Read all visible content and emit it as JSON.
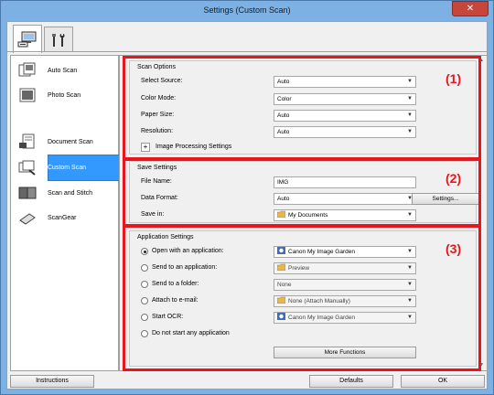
{
  "window": {
    "title": "Settings (Custom Scan)",
    "close_label": "✕"
  },
  "tabs": [
    {
      "icon": "scan-from-computer-icon",
      "active": true
    },
    {
      "icon": "general-settings-tools-icon",
      "active": false
    }
  ],
  "sidebar": {
    "items": [
      {
        "label": "Auto Scan",
        "icon": "auto-scan-icon"
      },
      {
        "label": "Photo Scan",
        "icon": "photo-scan-icon"
      },
      {
        "label": "Document Scan",
        "icon": "document-scan-icon"
      },
      {
        "label": "Custom Scan",
        "icon": "custom-scan-icon",
        "selected": true
      },
      {
        "label": "Scan and Stitch",
        "icon": "scan-and-stitch-icon"
      },
      {
        "label": "ScanGear",
        "icon": "scangear-icon"
      }
    ]
  },
  "scan_options": {
    "title": "Scan Options",
    "marker": "(1)",
    "rows": [
      {
        "label": "Select Source:",
        "value": "Auto"
      },
      {
        "label": "Color Mode:",
        "value": "Color"
      },
      {
        "label": "Paper Size:",
        "value": "Auto"
      },
      {
        "label": "Resolution:",
        "value": "Auto"
      }
    ],
    "image_processing_label": "Image Processing Settings",
    "expand_symbol": "+"
  },
  "save_settings": {
    "title": "Save Settings",
    "marker": "(2)",
    "file_name_label": "File Name:",
    "file_name_value": "IMG",
    "data_format_label": "Data Format:",
    "data_format_value": "Auto",
    "settings_button": "Settings...",
    "save_in_label": "Save in:",
    "save_in_value": "My Documents"
  },
  "application_settings": {
    "title": "Application Settings",
    "marker": "(3)",
    "rows": [
      {
        "label": "Open with an application:",
        "value": "Canon My Image Garden",
        "selected": true,
        "icon": "image-garden-icon"
      },
      {
        "label": "Send to an application:",
        "value": "Preview",
        "selected": false,
        "icon": "folder-icon"
      },
      {
        "label": "Send to a folder:",
        "value": "None",
        "selected": false,
        "icon": ""
      },
      {
        "label": "Attach to e-mail:",
        "value": "None (Attach Manually)",
        "selected": false,
        "icon": "folder-icon"
      },
      {
        "label": "Start OCR:",
        "value": "Canon My Image Garden",
        "selected": false,
        "icon": "image-garden-icon"
      },
      {
        "label": "Do not start any application",
        "value": "",
        "selected": false,
        "icon": ""
      }
    ],
    "more_functions_button": "More Functions"
  },
  "footer": {
    "instructions_button": "Instructions",
    "defaults_button": "Defaults",
    "ok_button": "OK"
  },
  "colors": {
    "highlight_red": "#e8151d",
    "selection_blue": "#3399ff",
    "window_frame": "#7eb1e3"
  }
}
